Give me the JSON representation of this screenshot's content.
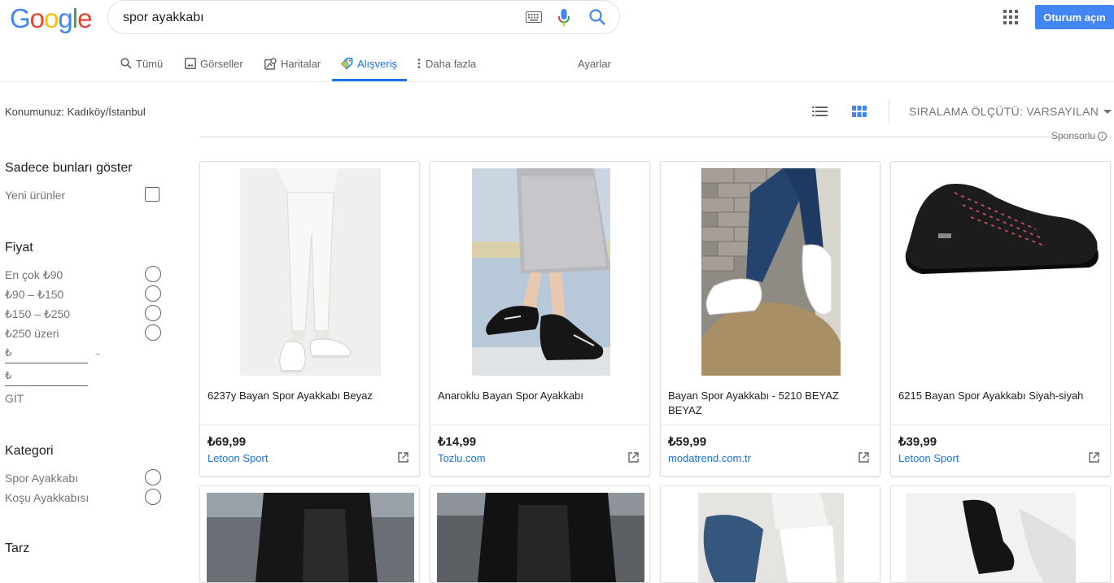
{
  "header": {
    "logo_letters": [
      "G",
      "o",
      "o",
      "g",
      "l",
      "e"
    ],
    "logo_colors": [
      "#4285f4",
      "#ea4335",
      "#fbbc05",
      "#4285f4",
      "#34a853",
      "#ea4335"
    ],
    "search_value": "spor ayakkabı",
    "signin_label": "Oturum açın",
    "icons": [
      "keyboard-icon",
      "mic-icon",
      "search-icon",
      "apps-grid-icon"
    ]
  },
  "tabs": [
    {
      "label": "Tümü",
      "icon": "search-icon"
    },
    {
      "label": "Görseller",
      "icon": "image-icon"
    },
    {
      "label": "Haritalar",
      "icon": "map-icon"
    },
    {
      "label": "Alışveriş",
      "icon": "tag-icon",
      "active": true
    },
    {
      "label": "Daha fazla",
      "icon": "more-vert-icon"
    },
    {
      "label": "Ayarlar"
    }
  ],
  "location": "Konumunuz: Kadıköy/İstanbul",
  "sort_label": "SIRALAMA ÖLÇÜTÜ: VARSAYILAN",
  "sponsored": "Sponsorlu",
  "sidebar": {
    "show_only": {
      "heading": "Sadece bunları göster",
      "option": "Yeni ürünler"
    },
    "price": {
      "heading": "Fiyat",
      "options": [
        "En çok ₺90",
        "₺90 – ₺150",
        "₺150 – ₺250",
        "₺250 üzeri"
      ],
      "min_prefix": "₺",
      "max_prefix": "₺",
      "dash": "-",
      "go": "GİT"
    },
    "category": {
      "heading": "Kategori",
      "options": [
        "Spor Ayakkabı",
        "Koşu Ayakkabısı"
      ]
    },
    "style_heading": "Tarz"
  },
  "products": [
    {
      "title": "6237y Bayan Spor Ayakkabı Beyaz",
      "price": "₺69,99",
      "seller": "Letoon Sport"
    },
    {
      "title": "Anaroklu Bayan Spor Ayakkabı",
      "price": "₺14,99",
      "seller": "Tozlu.com"
    },
    {
      "title": "Bayan Spor Ayakkabı - 5210 BEYAZ BEYAZ",
      "price": "₺59,99",
      "seller": "modatrend.com.tr"
    },
    {
      "title": "6215 Bayan Spor Ayakkabı Siyah-siyah",
      "price": "₺39,99",
      "seller": "Letoon Sport"
    }
  ]
}
